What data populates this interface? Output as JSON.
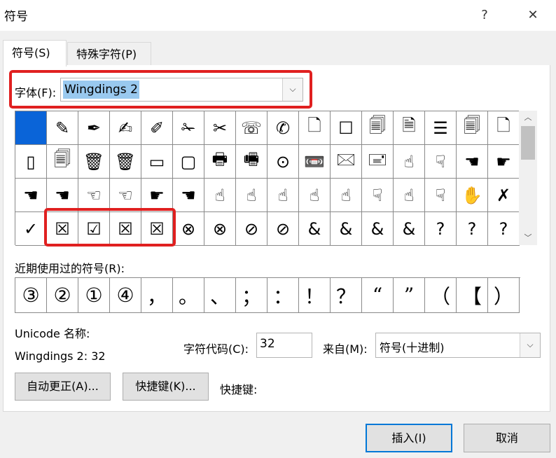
{
  "window": {
    "title": "符号",
    "help_icon": "?",
    "close_icon": "✕"
  },
  "tabs": [
    {
      "label": "符号(S)"
    },
    {
      "label": "特殊字符(P)"
    }
  ],
  "font": {
    "label": "字体(F):",
    "value": "Wingdings 2"
  },
  "symbols": [
    "",
    "✎",
    "✒",
    "✍",
    "✐",
    "✁",
    "✂",
    "☏",
    "✆",
    "🗋",
    "☐",
    "🗐",
    "🗎",
    "☰",
    "🗐",
    "🗋",
    "▯",
    "🗐",
    "🗑",
    "🗑",
    "▭",
    "▢",
    "🖶",
    "🖷",
    "⊙",
    "📼",
    "🖂",
    "🖃",
    "☝",
    "☟",
    "☚",
    "☛",
    "☚",
    "☚",
    "☜",
    "☜",
    "☛",
    "☚",
    "☝",
    "☝",
    "☝",
    "☝",
    "☝",
    "☟",
    "☝",
    "☟",
    "✋",
    "✗",
    "✓",
    "☒",
    "☑",
    "☒",
    "☒",
    "⊗",
    "⊗",
    "⊘",
    "⊘",
    "&",
    "&",
    "&",
    "&",
    "?",
    "?",
    "?"
  ],
  "recent": {
    "label": "近期使用过的符号(R):",
    "symbols": [
      "③",
      "②",
      "①",
      "④",
      "，",
      "。",
      "、",
      "；",
      "：",
      "！",
      "？",
      "“",
      "”",
      "（",
      "【",
      "）"
    ]
  },
  "unicode": {
    "label": "Unicode 名称:",
    "value": "Wingdings 2: 32"
  },
  "char_code": {
    "label": "字符代码(C):",
    "value": "32"
  },
  "from": {
    "label": "来自(M):",
    "value": "符号(十进制)"
  },
  "buttons": {
    "autocorrect": "自动更正(A)...",
    "shortcut_key": "快捷键(K)...",
    "shortcut_label": "快捷键:",
    "insert": "插入(I)",
    "cancel": "取消"
  },
  "icons": {
    "dropdown": "chevron-down-icon",
    "scroll_up": "chevron-up-icon",
    "scroll_down": "chevron-down-icon"
  },
  "colors": {
    "selection": "#0a64d8",
    "highlight_box": "#e02020",
    "font_value_bg": "#99c9ef",
    "primary_border": "#0078d7"
  }
}
